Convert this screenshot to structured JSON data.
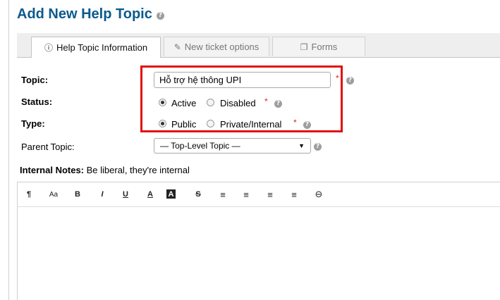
{
  "page": {
    "title": "Add New Help Topic"
  },
  "tabs": [
    {
      "label": "Help Topic Information",
      "icon": "info-circle-icon"
    },
    {
      "label": "New ticket options",
      "icon": "ticket-icon"
    },
    {
      "label": "Forms",
      "icon": "copy-icon"
    }
  ],
  "form": {
    "topic": {
      "label": "Topic:",
      "value": "Hỗ trợ hệ thông UPI"
    },
    "status": {
      "label": "Status:",
      "options": [
        "Active",
        "Disabled"
      ],
      "selected": "Active"
    },
    "type": {
      "label": "Type:",
      "options": [
        "Public",
        "Private/Internal"
      ],
      "selected": "Public"
    },
    "parent_topic": {
      "label": "Parent Topic:",
      "value": "— Top-Level Topic —"
    },
    "required_mark": "*",
    "help_mark": "?"
  },
  "notes": {
    "label": "Internal Notes:",
    "text": " Be liberal, they're internal"
  },
  "toolbar": {
    "glyphs": [
      "¶",
      "Aa",
      "B",
      "I",
      "U",
      "A",
      "A",
      "S",
      "≡",
      "≡",
      "≡",
      "≡",
      "⊖"
    ],
    "icons": [
      "paragraph-icon",
      "font-size-icon",
      "bold-icon",
      "italic-icon",
      "underline-icon",
      "font-color-icon",
      "background-color-icon",
      "strikethrough-icon",
      "unordered-list-icon",
      "ordered-list-icon",
      "outdent-icon",
      "indent-icon",
      "link-icon"
    ]
  },
  "colors": {
    "title": "#0a5a8f",
    "required": "#e02020",
    "highlight": "#e01010"
  }
}
